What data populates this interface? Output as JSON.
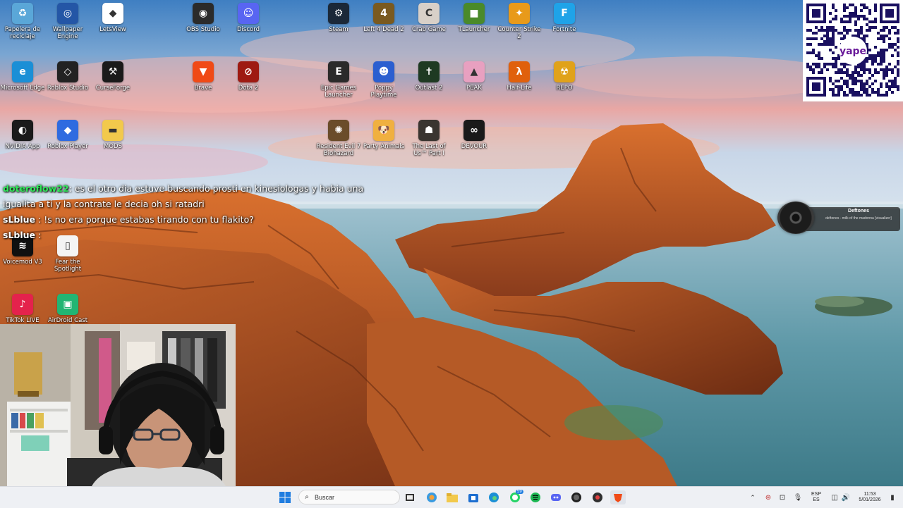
{
  "desktop": {
    "icons": [
      {
        "label": "Papelera de reciclaje",
        "icon": "recycle-bin-icon",
        "color": "#5aa7d8",
        "glyph": "♻"
      },
      {
        "label": "Wallpaper Engine",
        "icon": "wallpaper-engine-icon",
        "color": "#2456a6",
        "glyph": "◎"
      },
      {
        "label": "LetsView",
        "icon": "letsview-icon",
        "color": "#ffffff",
        "glyph": "◆"
      },
      {
        "label": "OBS Studio",
        "icon": "obs-icon",
        "color": "#2b2b2b",
        "glyph": "◉"
      },
      {
        "label": "Discord",
        "icon": "discord-icon",
        "color": "#5865f2",
        "glyph": "☺"
      },
      {
        "label": "Steam",
        "icon": "steam-icon",
        "color": "#1b2838",
        "glyph": "⚙"
      },
      {
        "label": "Left 4 Dead 2",
        "icon": "left4dead2-icon",
        "color": "#7a5a20",
        "glyph": "4"
      },
      {
        "label": "Crab Game",
        "icon": "crab-game-icon",
        "color": "#d8d0c8",
        "glyph": "C"
      },
      {
        "label": "TLauncher",
        "icon": "tlauncher-icon",
        "color": "#4a8a2a",
        "glyph": "■"
      },
      {
        "label": "Counter Strike 2",
        "icon": "counter-strike-icon",
        "color": "#e89a1a",
        "glyph": "✦"
      },
      {
        "label": "Fortnite",
        "icon": "fortnite-icon",
        "color": "#1fa3e8",
        "glyph": "F"
      },
      {
        "label": "Microsoft Edge",
        "icon": "edge-icon",
        "color": "#1b8fd6",
        "glyph": "e"
      },
      {
        "label": "Roblox Studio",
        "icon": "roblox-studio-icon",
        "color": "#222222",
        "glyph": "◇"
      },
      {
        "label": "CurseForge",
        "icon": "curseforge-icon",
        "color": "#1a1a1a",
        "glyph": "⚒"
      },
      {
        "label": "Brave",
        "icon": "brave-icon",
        "color": "#f04a16",
        "glyph": "▼"
      },
      {
        "label": "Dota 2",
        "icon": "dota2-icon",
        "color": "#9e1a12",
        "glyph": "⊘"
      },
      {
        "label": "Epic Games Launcher",
        "icon": "epic-games-icon",
        "color": "#2a2a2a",
        "glyph": "E"
      },
      {
        "label": "Poppy Playtime",
        "icon": "poppy-playtime-icon",
        "color": "#2b5fd0",
        "glyph": "☻"
      },
      {
        "label": "Outlast 2",
        "icon": "outlast2-icon",
        "color": "#1e3a22",
        "glyph": "✝"
      },
      {
        "label": "PEAK",
        "icon": "peak-icon",
        "color": "#e8a0c0",
        "glyph": "▲"
      },
      {
        "label": "Half-Life",
        "icon": "half-life-icon",
        "color": "#e0600c",
        "glyph": "λ"
      },
      {
        "label": "REPO",
        "icon": "repo-icon",
        "color": "#e0a21a",
        "glyph": "☢"
      },
      {
        "label": "NVIDIA App",
        "icon": "nvidia-icon",
        "color": "#1a1a1a",
        "glyph": "◐"
      },
      {
        "label": "Roblox Player",
        "icon": "roblox-player-icon",
        "color": "#2f6be0",
        "glyph": "◆"
      },
      {
        "label": "MODS",
        "icon": "folder-icon",
        "color": "#f2c94c",
        "glyph": "▬"
      },
      {
        "label": "Resident Evil 7 Biohazard",
        "icon": "resident-evil-icon",
        "color": "#6a4c2a",
        "glyph": "✺"
      },
      {
        "label": "Party Animals",
        "icon": "party-animals-icon",
        "color": "#f0b040",
        "glyph": "🐶"
      },
      {
        "label": "The Last of Us™ Part I",
        "icon": "last-of-us-icon",
        "color": "#3a3530",
        "glyph": "☗"
      },
      {
        "label": "DEVOUR",
        "icon": "devour-icon",
        "color": "#1a1a1a",
        "glyph": "∞"
      },
      {
        "label": "Voicemod V3",
        "icon": "voicemod-icon",
        "color": "#101010",
        "glyph": "≋"
      },
      {
        "label": "Fear the Spotlight",
        "icon": "fear-the-spotlight-icon",
        "color": "#f4f4f4",
        "glyph": "▯"
      },
      {
        "label": "TikTok LIVE",
        "icon": "tiktok-live-icon",
        "color": "#e4224c",
        "glyph": "♪"
      },
      {
        "label": "AirDroid Cast",
        "icon": "airdroid-cast-icon",
        "color": "#22b573",
        "glyph": "▣"
      }
    ]
  },
  "chat": {
    "messages": [
      {
        "user": "doteroflow22",
        "sep": ":",
        "text": "es el otro dia estuve buscando prosti en kinesiologas y habia una"
      },
      {
        "user": "",
        "sep": "",
        "text": "igualita a ti y la contrate le decia oh si ratadri"
      },
      {
        "user": "sLblue",
        "sep": ":",
        "text": "!s no era porque estabas tirando con tu flakito?"
      },
      {
        "user": "sLblue",
        "sep": ":",
        "text": ""
      }
    ],
    "user_colors": {
      "doteroflow22": "#31e85a",
      "sLblue": "#ffffff"
    }
  },
  "music": {
    "artist": "Deftones",
    "track": "deftones - milk of the madonna [visualizer]"
  },
  "taskbar": {
    "search_placeholder": "Buscar",
    "language_top": "ESP",
    "language_bottom": "ES",
    "time": "11:53",
    "date": "5/01/2026",
    "whatsapp_badge": "59"
  },
  "qr": {
    "brand": "yape"
  }
}
